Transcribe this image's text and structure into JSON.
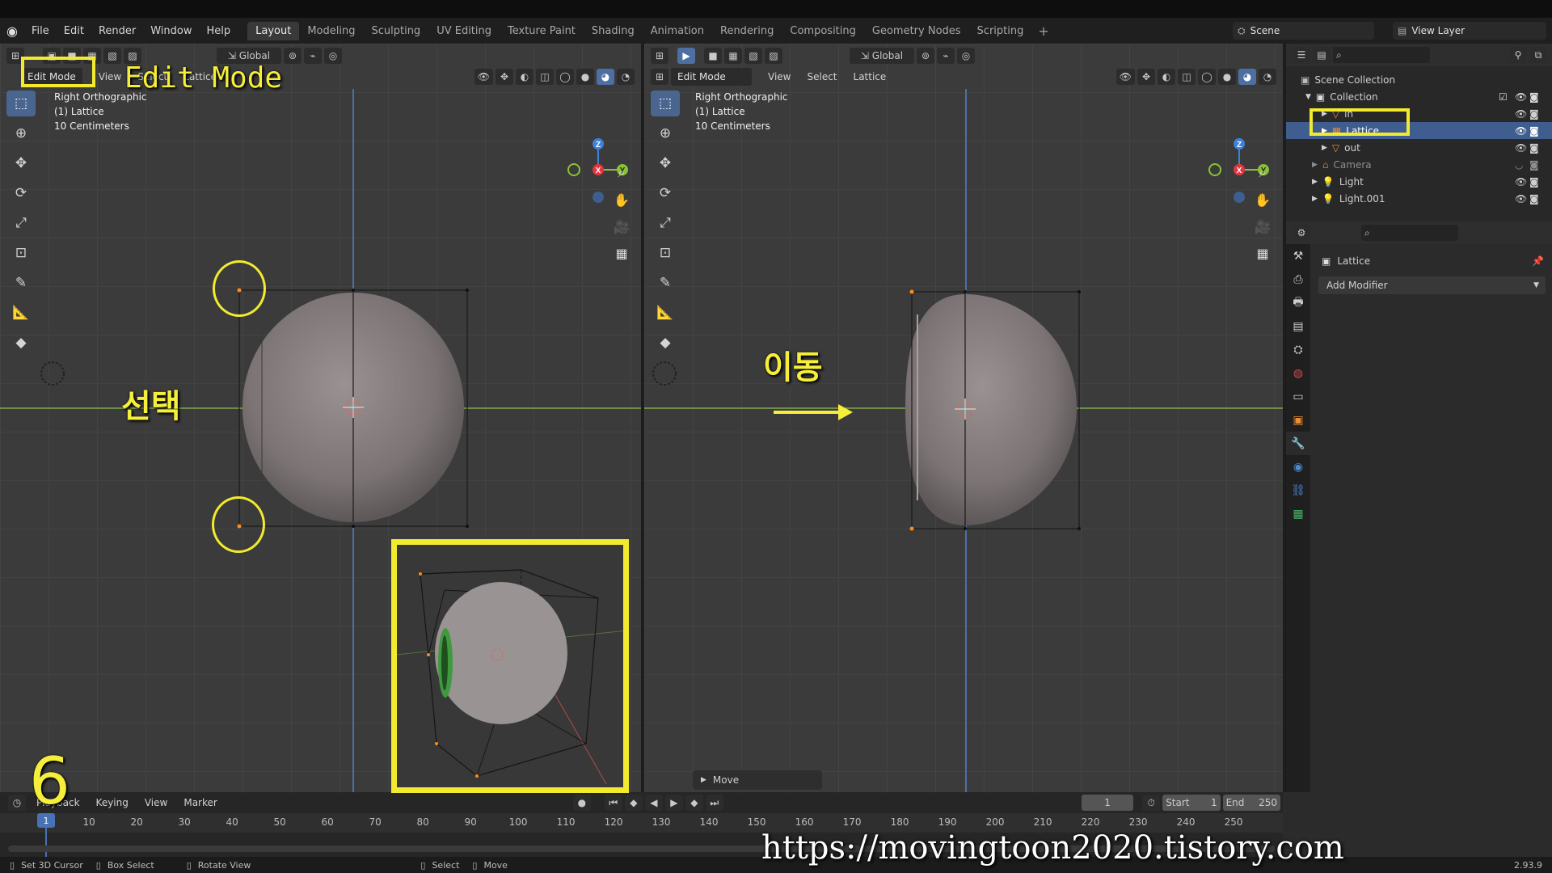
{
  "menubar": {
    "menus": [
      "File",
      "Edit",
      "Render",
      "Window",
      "Help"
    ],
    "workspaces": [
      "Layout",
      "Modeling",
      "Sculpting",
      "UV Editing",
      "Texture Paint",
      "Shading",
      "Animation",
      "Rendering",
      "Compositing",
      "Geometry Nodes",
      "Scripting"
    ],
    "active_workspace": "Layout",
    "add": "+",
    "scene": "Scene",
    "view_layer": "View Layer"
  },
  "left_viewport": {
    "orientation": "Global",
    "mode": "Edit Mode",
    "menus": [
      "View",
      "Select",
      "Lattice"
    ],
    "view_name": "Right Orthographic",
    "object_line": "(1) Lattice",
    "scale_line": "10 Centimeters"
  },
  "right_viewport": {
    "orientation": "Global",
    "mode": "Edit Mode",
    "menus": [
      "View",
      "Select",
      "Lattice"
    ],
    "view_name": "Right Orthographic",
    "object_line": "(1) Lattice",
    "scale_line": "10 Centimeters",
    "operator_panel": "Move"
  },
  "gizmo": {
    "z": "Z",
    "x": "X",
    "y": "Y"
  },
  "annotations": {
    "edit_mode_label": "Edit Mode",
    "select_label": "선택",
    "move_label": "이동",
    "step_number": "6",
    "watermark": "https://movingtoon2020.tistory.com"
  },
  "outliner": {
    "root": "Scene Collection",
    "collection": "Collection",
    "items": [
      "in",
      "Lattice",
      "out",
      "Camera",
      "Light",
      "Light.001"
    ]
  },
  "properties": {
    "object_name": "Lattice",
    "add_modifier": "Add Modifier"
  },
  "timeline": {
    "menus": [
      "Playback",
      "Keying",
      "View",
      "Marker"
    ],
    "current_frame": "1",
    "start_label": "Start",
    "start": "1",
    "end_label": "End",
    "end": "250",
    "ticks": [
      "1",
      "10",
      "20",
      "30",
      "40",
      "50",
      "60",
      "70",
      "80",
      "90",
      "100",
      "110",
      "120",
      "130",
      "140",
      "150",
      "160",
      "170",
      "180",
      "190",
      "200",
      "210",
      "220",
      "230",
      "240",
      "250"
    ]
  },
  "statusbar": {
    "items": [
      "Set 3D Cursor",
      "Box Select",
      "Rotate View",
      "Select",
      "Move"
    ],
    "version": "2.93.9"
  },
  "colors": {
    "highlight": "#f2ea2e",
    "x_axis": "#e5343f",
    "y_axis": "#8ac136",
    "z_axis": "#3d82d8",
    "selection": "#3f5e8f"
  }
}
